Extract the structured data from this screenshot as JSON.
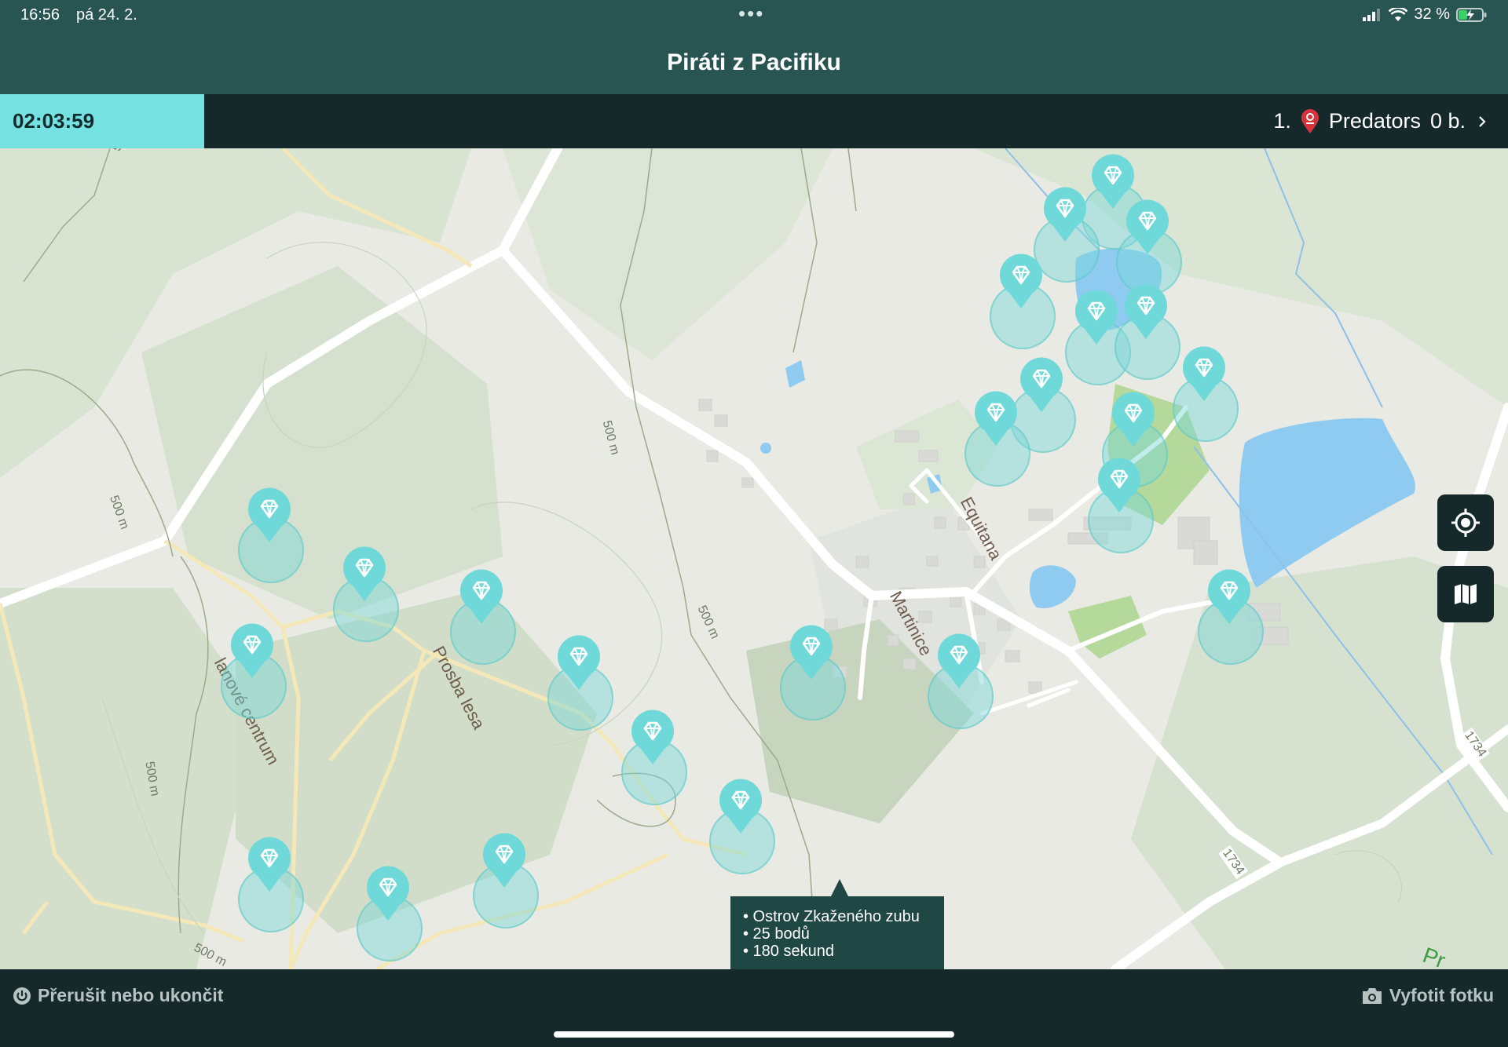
{
  "status_bar": {
    "time": "16:56",
    "date": "pá 24. 2.",
    "battery": "32 %"
  },
  "header": {
    "title": "Piráti z Pacifiku"
  },
  "timer": {
    "value": "02:03:59"
  },
  "leaderboard": {
    "rank": "1.",
    "team": "Predators",
    "score": "0 b."
  },
  "map": {
    "labels": {
      "village": "Martinice",
      "street1": "Equitana",
      "street2": "Prosba lesa",
      "street3": "lanové centrum",
      "contour": "500 m",
      "road": "1734",
      "edge": "Pr"
    },
    "tooltip": {
      "lines": [
        "• Ostrov Zkaženého zubu",
        "• 25 bodů",
        "• 180 sekund"
      ]
    },
    "marker_icon": "diamond-icon"
  },
  "buttons": {
    "locate_icon": "locate-icon",
    "layers_icon": "map-icon"
  },
  "bottom_bar": {
    "stop_label": "Přerušit nebo ukončit",
    "photo_label": "Vyfotit fotku"
  },
  "colors": {
    "accent": "#76E1E1",
    "header_bg": "#285451",
    "bar_bg": "#15292B",
    "marker": "#6FD9D9",
    "water": "#8FCBF0"
  }
}
